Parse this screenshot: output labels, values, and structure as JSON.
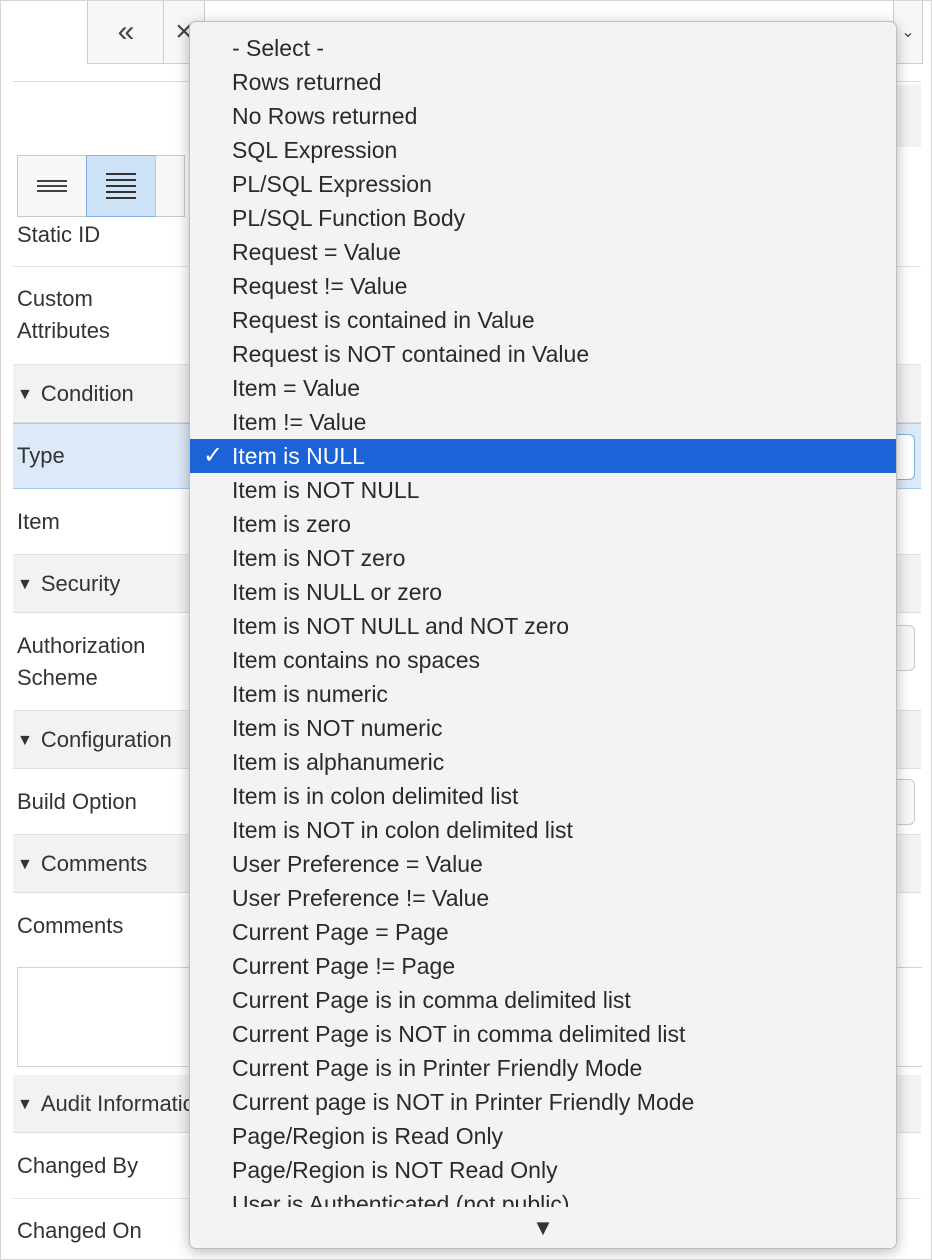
{
  "toolbar": {
    "collapse_icon": "double-chevron-left-icon",
    "collapse_glyph": "«",
    "close_glyph": "×"
  },
  "properties": {
    "static_id_label": "Static ID",
    "custom_attributes_label_1": "Custom",
    "custom_attributes_label_2": "Attributes",
    "condition_section": "Condition",
    "type_label": "Type",
    "item_label": "Item",
    "security_section": "Security",
    "auth_label_1": "Authorization",
    "auth_label_2": "Scheme",
    "configuration_section": "Configuration",
    "build_option_label": "Build Option",
    "comments_section": "Comments",
    "comments_label": "Comments",
    "audit_section": "Audit Information",
    "changed_by_label": "Changed By",
    "changed_on_label": "Changed On"
  },
  "dropdown": {
    "selected_index": 12,
    "check_glyph": "✓",
    "scroll_down_glyph": "▼",
    "options": [
      "- Select -",
      "Rows returned",
      "No Rows returned",
      "SQL Expression",
      "PL/SQL Expression",
      "PL/SQL Function Body",
      "Request = Value",
      "Request != Value",
      "Request is contained in Value",
      "Request is NOT contained in Value",
      "Item = Value",
      "Item != Value",
      "Item is NULL",
      "Item is NOT NULL",
      "Item is zero",
      "Item is NOT zero",
      "Item is NULL or zero",
      "Item is NOT NULL and NOT zero",
      "Item contains no spaces",
      "Item is numeric",
      "Item is NOT numeric",
      "Item is alphanumeric",
      "Item is in colon delimited list",
      "Item is NOT in colon delimited list",
      "User Preference = Value",
      "User Preference != Value",
      "Current Page = Page",
      "Current Page != Page",
      "Current Page is in comma delimited list",
      "Current Page is NOT in comma delimited list",
      "Current Page is in Printer Friendly Mode",
      "Current page is NOT in Printer Friendly Mode",
      "Page/Region is Read Only",
      "Page/Region is NOT Read Only",
      "User is Authenticated (not public)"
    ]
  }
}
